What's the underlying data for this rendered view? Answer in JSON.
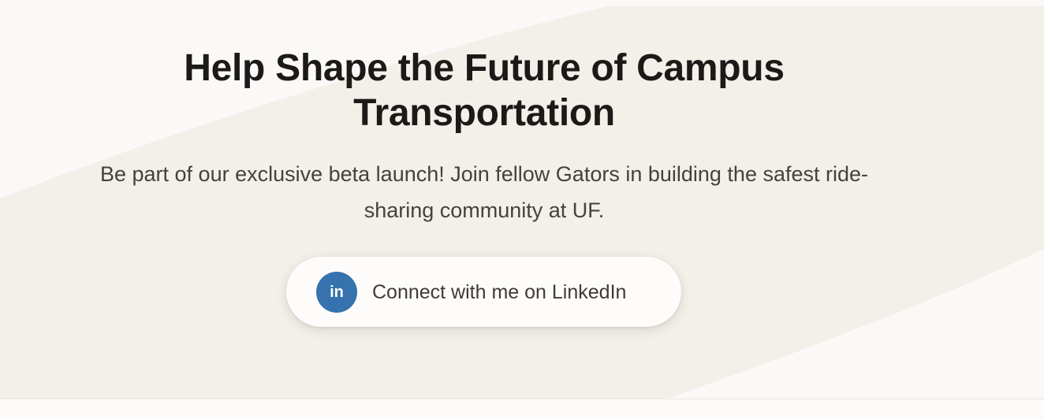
{
  "hero": {
    "headline": "Help Shape the Future of Campus Transportation",
    "subtitle": "Be part of our exclusive beta launch! Join fellow Gators in building the safest ride-sharing community at UF."
  },
  "cta": {
    "label": "Connect with me on LinkedIn",
    "icon": "linkedin-icon",
    "icon_text": "in",
    "icon_color": "#3572ae"
  },
  "colors": {
    "background": "#faf9f7",
    "wave": "#f3efe9",
    "heading": "#1c1a18",
    "body_text": "#45413d"
  }
}
